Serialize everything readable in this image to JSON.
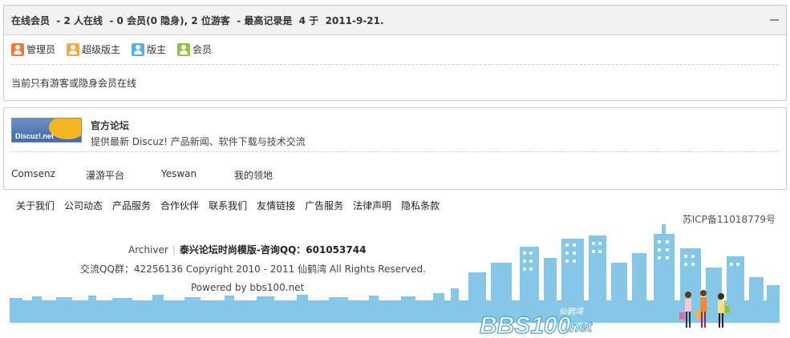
{
  "online": {
    "header": "在线会员  - 2 人在线  - 0 会员(0 隐身), 2 位游客  - 最高记录是  4 于  2011-9-21.",
    "legend": [
      {
        "label": "管理员",
        "icon": "admin-icon",
        "color": "#ef7a3b"
      },
      {
        "label": "超级版主",
        "icon": "super-moderator-icon",
        "color": "#f2a94a"
      },
      {
        "label": "版主",
        "icon": "moderator-icon",
        "color": "#58aee6"
      },
      {
        "label": "会员",
        "icon": "member-icon",
        "color": "#8cc63f"
      }
    ],
    "status_text": "当前只有游客或隐身会员在线"
  },
  "links": {
    "logo_text": "Discuz!.net",
    "title": "官方论坛",
    "description": "提供最新 Discuz! 产品新闻、软件下载与技术交流",
    "friends": [
      "Comsenz",
      "漫游平台",
      "Yeswan",
      "我的领地"
    ]
  },
  "footer": {
    "nav": [
      "关于我们",
      "公司动态",
      "产品服务",
      "合作伙伴",
      "联系我们",
      "友情链接",
      "广告服务",
      "法律声明",
      "隐私条款"
    ],
    "icp": "苏ICP备11018779号",
    "archiver": "Archiver",
    "site_info": "泰兴论坛时尚模版-咨询QQ：601053744",
    "copyright": "交流QQ群：42256136 Copyright 2010 - 2011 仙鹤湾  All Rights Reserved.",
    "powered": "Powered by bbs100.net",
    "brand_main": "BBS100",
    "brand_suffix": ".net",
    "brand_cn": "仙鹤湾"
  },
  "colors": {
    "city": "#86c6e6",
    "brand": "#4aa0d8"
  }
}
